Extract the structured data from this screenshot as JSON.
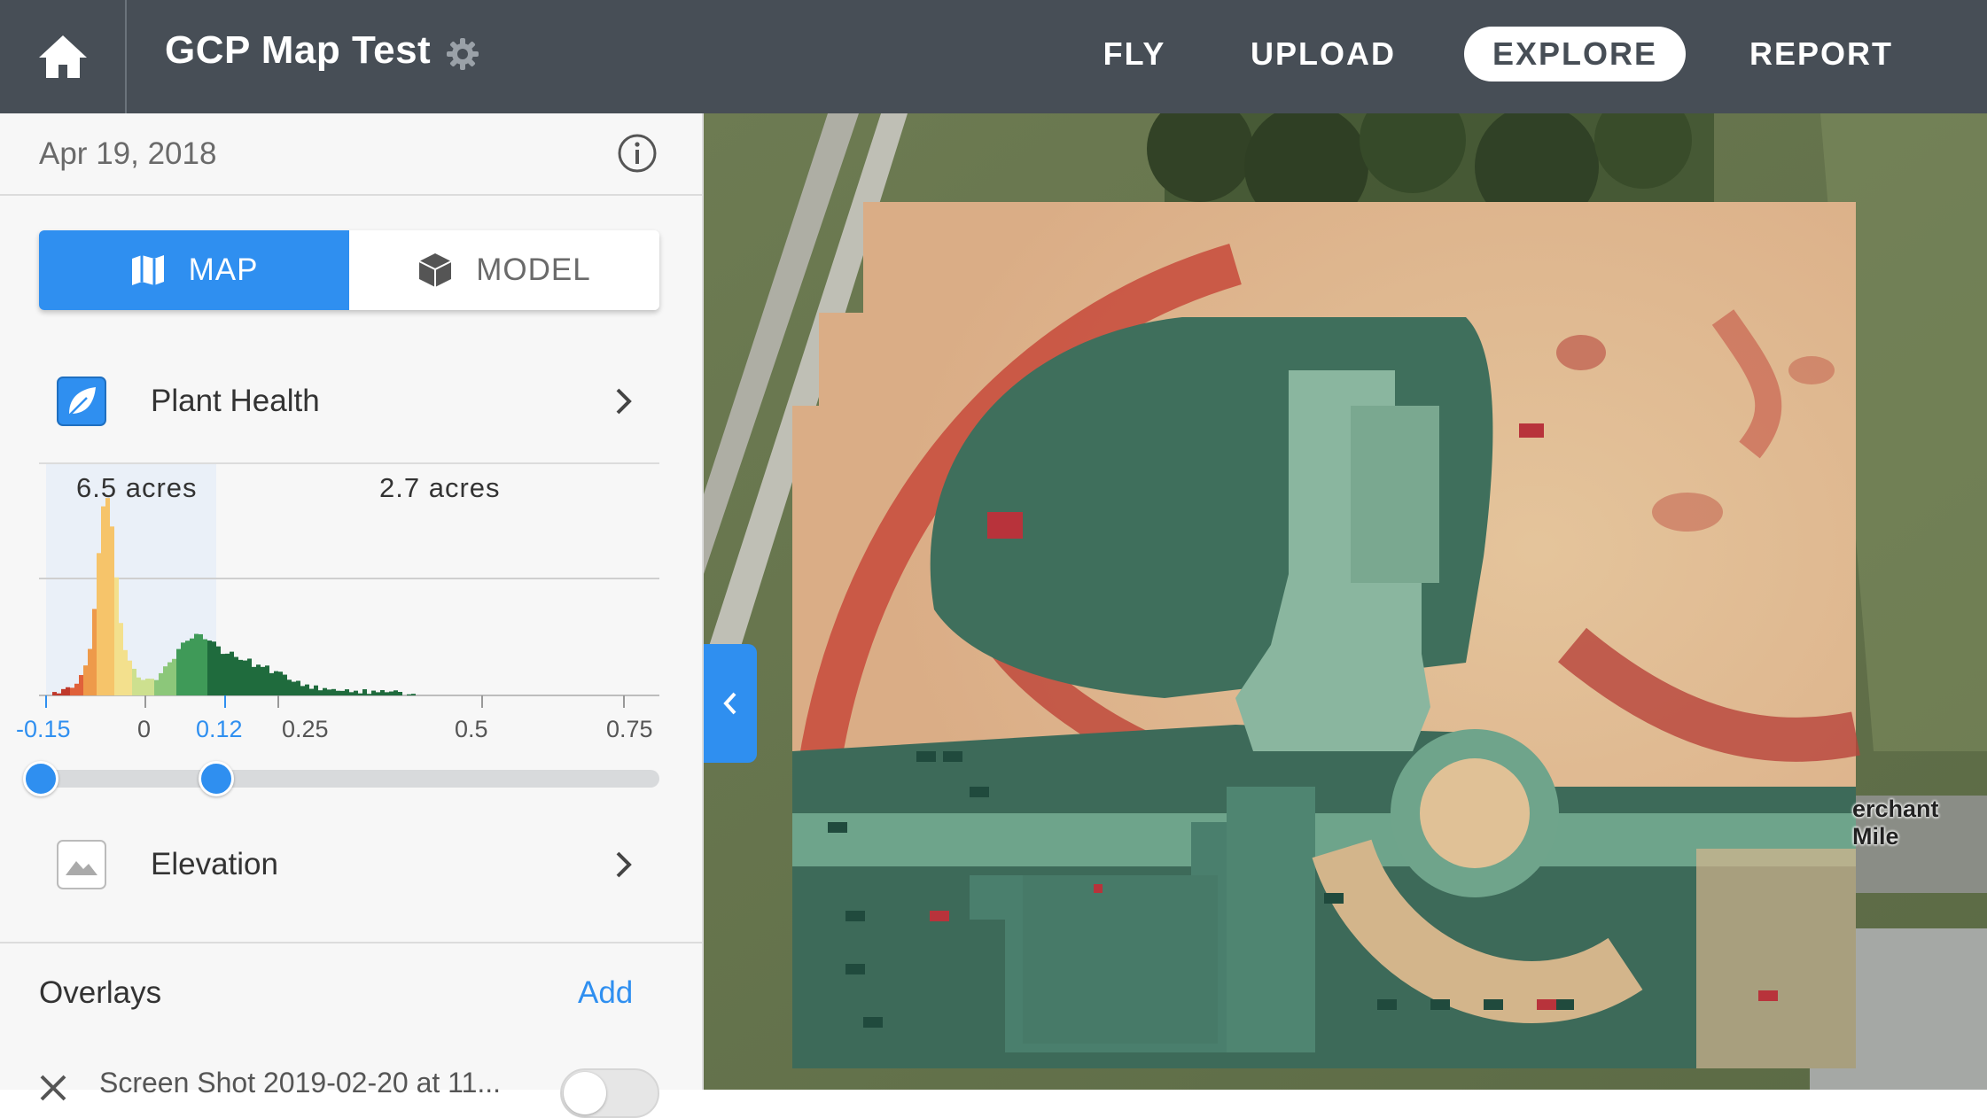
{
  "header": {
    "title": "GCP Map Test",
    "nav": [
      "FLY",
      "UPLOAD",
      "EXPLORE",
      "REPORT"
    ],
    "active_nav": "EXPLORE"
  },
  "sidebar": {
    "date": "Apr 19, 2018",
    "view_toggle": {
      "map": "MAP",
      "model": "MODEL",
      "selected": "MAP"
    },
    "layers": {
      "plant_health": "Plant Health",
      "elevation": "Elevation"
    },
    "histogram": {
      "acres_left": "6.5 acres",
      "acres_right": "2.7 acres",
      "ticks": [
        "-0.15",
        "0",
        "0.12",
        "0.25",
        "0.5",
        "0.75"
      ],
      "range": {
        "min": -0.15,
        "max": 0.12
      }
    },
    "overlays": {
      "title": "Overlays",
      "add": "Add",
      "item": "Screen Shot 2019-02-20 at 11..."
    }
  },
  "map": {
    "street_label": "erchant Mile"
  },
  "colors": {
    "header_bg": "#474e56",
    "accent": "#2f8ff0",
    "sidebar_bg": "#f7f7f7"
  }
}
